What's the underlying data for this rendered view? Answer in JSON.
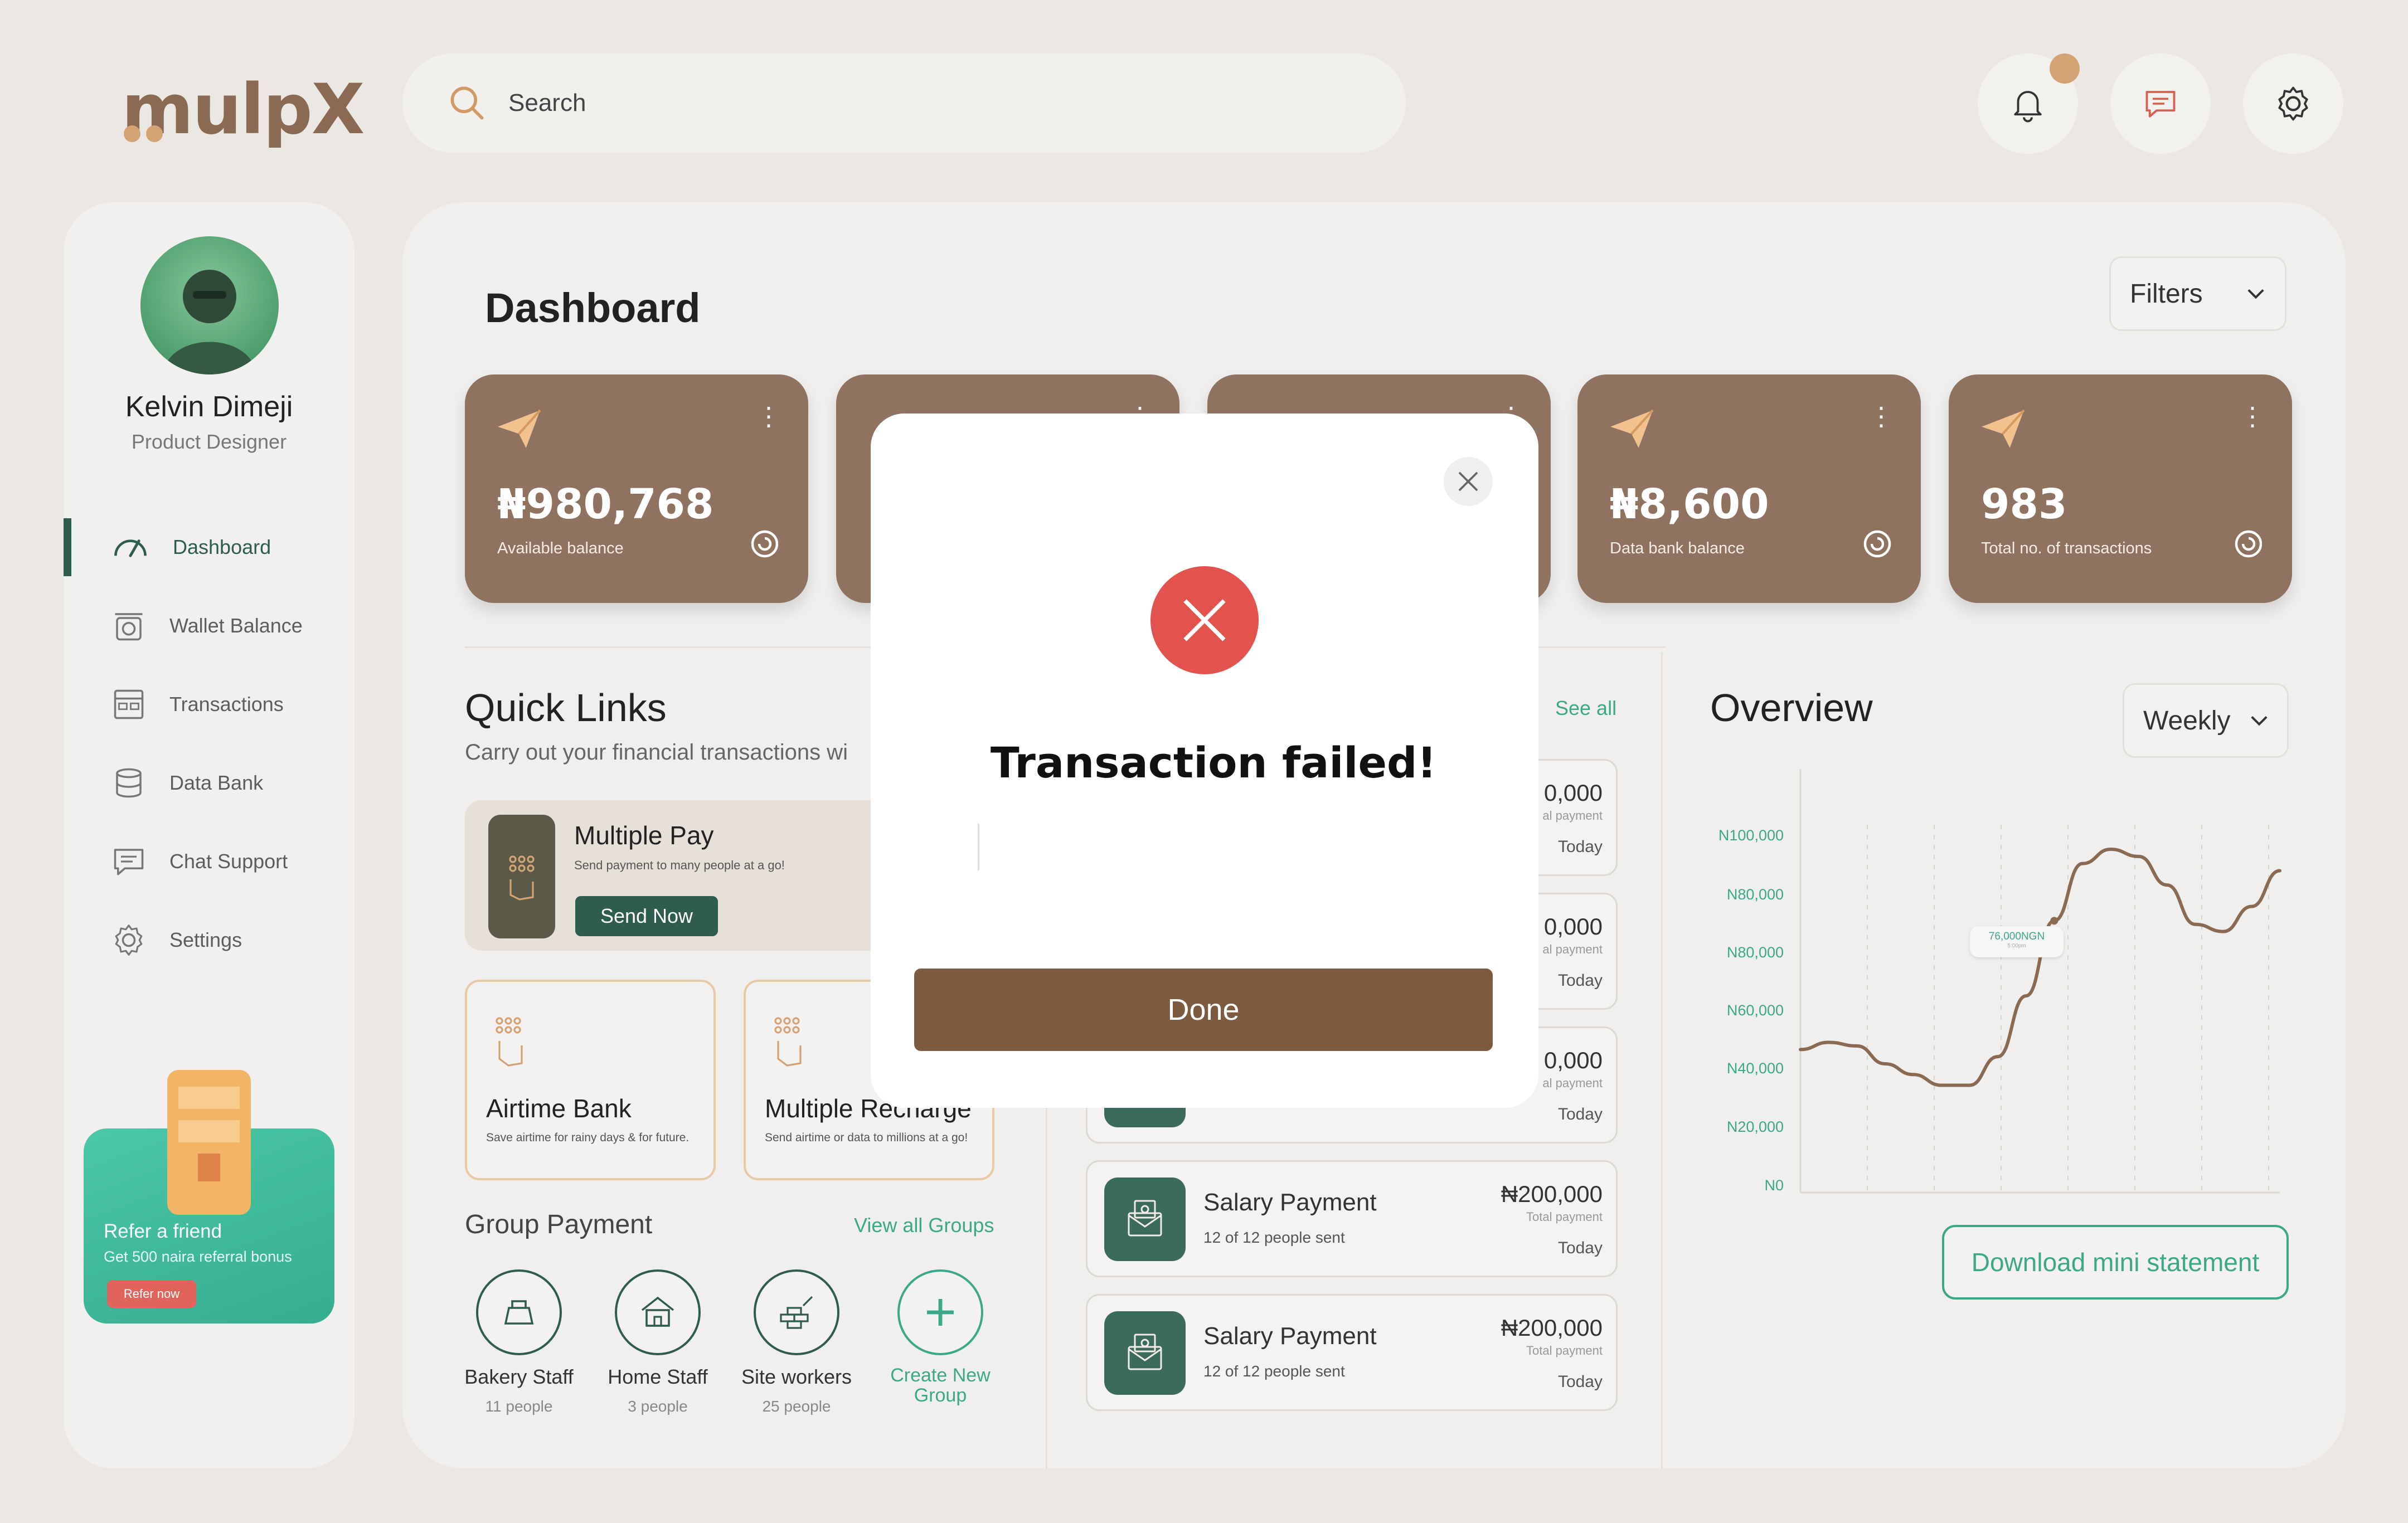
{
  "app": {
    "logo": "mulpX"
  },
  "search": {
    "placeholder": "Search"
  },
  "user": {
    "name": "Kelvin Dimeji",
    "role": "Product Designer"
  },
  "nav": [
    {
      "label": "Dashboard",
      "icon": "speedometer-icon",
      "active": true
    },
    {
      "label": "Wallet Balance",
      "icon": "scale-icon"
    },
    {
      "label": "Transactions",
      "icon": "transactions-icon"
    },
    {
      "label": "Data Bank",
      "icon": "database-icon"
    },
    {
      "label": "Chat Support",
      "icon": "chat-icon"
    },
    {
      "label": "Settings",
      "icon": "gear-icon"
    }
  ],
  "refer": {
    "title": "Refer a friend",
    "subtitle": "Get 500 naira referral bonus",
    "button": "Refer now"
  },
  "dashboard": {
    "title": "Dashboard",
    "filters": "Filters"
  },
  "cards": [
    {
      "value": "₦980,768",
      "label": "Available balance"
    },
    {
      "value": "",
      "label": ""
    },
    {
      "value": "",
      "label": ""
    },
    {
      "value": "₦8,600",
      "label": "Data bank balance"
    },
    {
      "value": "983",
      "label": "Total no. of transactions"
    }
  ],
  "quick_links": {
    "title": "Quick Links",
    "subtitle": "Carry out your financial transactions wi",
    "multiple_pay": {
      "title": "Multiple Pay",
      "subtitle": "Send payment to many people at a go!",
      "button": "Send Now"
    },
    "airtime": {
      "title": "Airtime Bank",
      "subtitle": "Save airtime for rainy days & for future."
    },
    "recharge": {
      "title": "Multiple Recharge",
      "subtitle": "Send airtime or data to millions at a go!"
    }
  },
  "group_payment": {
    "title": "Group Payment",
    "view_all": "View all Groups",
    "groups": [
      {
        "name": "Bakery Staff",
        "people": "11 people"
      },
      {
        "name": "Home Staff",
        "people": "3 people"
      },
      {
        "name": "Site workers",
        "people": "25 people"
      }
    ],
    "create": "Create New Group"
  },
  "transactions": {
    "see_all": "See all",
    "items": [
      {
        "amount": "0,000",
        "label": "al payment",
        "date": "Today"
      },
      {
        "amount": "0,000",
        "label": "al payment",
        "date": "Today"
      },
      {
        "amount": "0,000",
        "label": "al payment",
        "date": "Today"
      },
      {
        "title": "Salary Payment",
        "sub": "12 of 12 people sent",
        "amount": "₦200,000",
        "label": "Total payment",
        "date": "Today"
      },
      {
        "title": "Salary Payment",
        "sub": "12 of 12 people sent",
        "amount": "₦200,000",
        "label": "Total payment",
        "date": "Today"
      }
    ]
  },
  "overview": {
    "title": "Overview",
    "period": "Weekly",
    "download": "Download mini statement",
    "tooltip": "76,000NGN",
    "tooltip_sub": "5:00pm"
  },
  "chart_data": {
    "type": "line",
    "y_tick_labels": [
      "N100,000",
      "N80,000",
      "N80,000",
      "N60,000",
      "N40,000",
      "N20,000",
      "N0"
    ],
    "ylim": [
      0,
      120000
    ],
    "series": [
      {
        "values": [
          40000,
          42000,
          41000,
          36000,
          33000,
          30000,
          30000,
          38000,
          55000,
          76000,
          92000,
          96000,
          94000,
          86000,
          75000,
          73000,
          80000,
          90000
        ]
      }
    ]
  },
  "modal": {
    "title": "Transaction failed!",
    "button": "Done"
  },
  "colors": {
    "brown": "#8f7260",
    "green": "#2f5d4d",
    "teal": "#3aa889",
    "error": "#e2534d",
    "button": "#7d5b41"
  }
}
